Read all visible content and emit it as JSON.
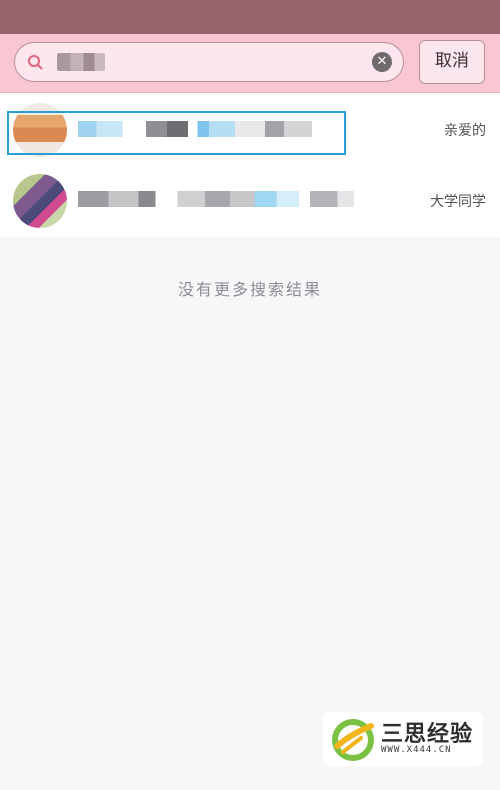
{
  "search": {
    "query": "",
    "clear_icon": "close-icon",
    "search_icon": "search-icon",
    "cancel_label": "取消"
  },
  "results": [
    {
      "name": "",
      "relation": "亲爱的",
      "selected": true
    },
    {
      "name": "",
      "relation": "大学同学",
      "selected": false
    }
  ],
  "empty_message": "没有更多搜索结果",
  "watermark": {
    "brand": "三思经验",
    "url": "WWW.X444.CN"
  },
  "colors": {
    "status_bar": "#94636c",
    "header": "#f9c7d2",
    "highlight": "#2a9ed8",
    "background": "#f7f7f9"
  }
}
